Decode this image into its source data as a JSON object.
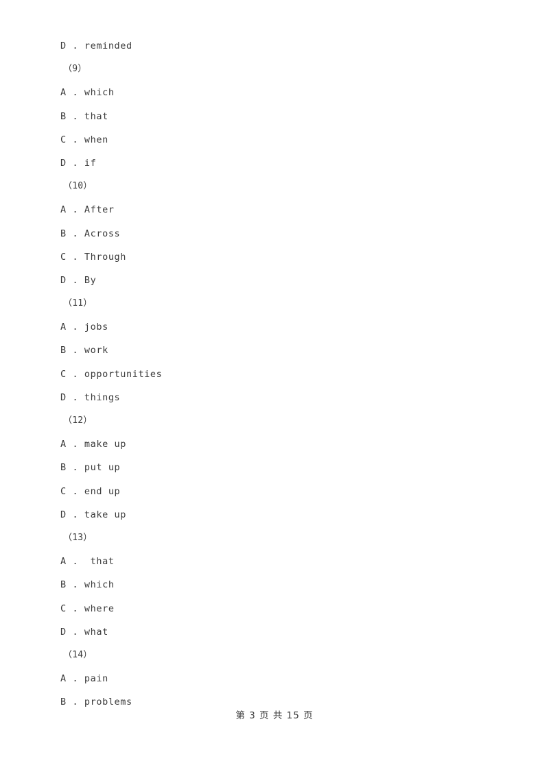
{
  "document": {
    "type": "exam-worksheet-page",
    "background_color": "#ffffff",
    "text_color": "#3a3a3a"
  },
  "body": {
    "lines": [
      {
        "kind": "option",
        "text": "D . reminded"
      },
      {
        "kind": "qnum",
        "text": "（9）"
      },
      {
        "kind": "option",
        "text": "A . which"
      },
      {
        "kind": "option",
        "text": "B . that"
      },
      {
        "kind": "option",
        "text": "C . when"
      },
      {
        "kind": "option",
        "text": "D . if"
      },
      {
        "kind": "qnum",
        "text": "（10）"
      },
      {
        "kind": "option",
        "text": "A . After"
      },
      {
        "kind": "option",
        "text": "B . Across"
      },
      {
        "kind": "option",
        "text": "C . Through"
      },
      {
        "kind": "option",
        "text": "D . By"
      },
      {
        "kind": "qnum",
        "text": "（11）"
      },
      {
        "kind": "option",
        "text": "A . jobs"
      },
      {
        "kind": "option",
        "text": "B . work"
      },
      {
        "kind": "option",
        "text": "C . opportunities"
      },
      {
        "kind": "option",
        "text": "D . things"
      },
      {
        "kind": "qnum",
        "text": "（12）"
      },
      {
        "kind": "option",
        "text": "A . make up"
      },
      {
        "kind": "option",
        "text": "B . put up"
      },
      {
        "kind": "option",
        "text": "C . end up"
      },
      {
        "kind": "option",
        "text": "D . take up"
      },
      {
        "kind": "qnum",
        "text": "（13）"
      },
      {
        "kind": "option",
        "text": "A .  that"
      },
      {
        "kind": "option",
        "text": "B . which"
      },
      {
        "kind": "option",
        "text": "C . where"
      },
      {
        "kind": "option",
        "text": "D . what"
      },
      {
        "kind": "qnum",
        "text": "（14）"
      },
      {
        "kind": "option",
        "text": "A . pain"
      },
      {
        "kind": "option",
        "text": "B . problems"
      }
    ]
  },
  "footer": {
    "text": "第 3 页 共 15 页",
    "current_page": "3",
    "total_pages": "15"
  }
}
